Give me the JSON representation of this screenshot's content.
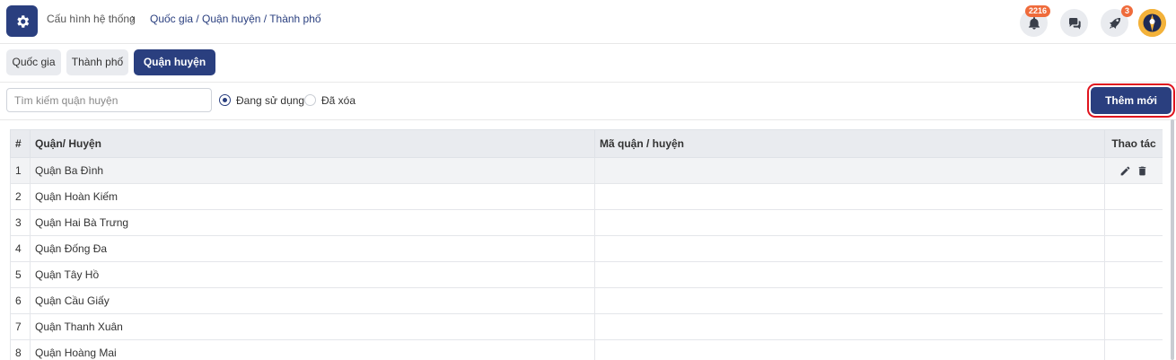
{
  "header": {
    "breadcrumb_root": "Cấu hình hệ thống",
    "breadcrumb_path": "Quốc gia / Quận huyện / Thành phố",
    "notification_count": "2216",
    "rocket_count": "3"
  },
  "tabs": [
    {
      "label": "Quốc gia"
    },
    {
      "label": "Thành phố"
    },
    {
      "label": "Quận huyện"
    }
  ],
  "toolbar": {
    "search_placeholder": "Tìm kiếm quận huyện",
    "radio_active": "Đang sử dụng",
    "radio_deleted": "Đã xóa",
    "add_button": "Thêm mới"
  },
  "table": {
    "headers": {
      "index": "#",
      "name": "Quận/ Huyện",
      "code": "Mã quận / huyện",
      "actions": "Thao tác"
    },
    "rows": [
      {
        "index": "1",
        "name": "Quận Ba Đình",
        "code": ""
      },
      {
        "index": "2",
        "name": "Quận Hoàn Kiếm",
        "code": ""
      },
      {
        "index": "3",
        "name": "Quận Hai Bà Trưng",
        "code": ""
      },
      {
        "index": "4",
        "name": "Quận Đống Đa",
        "code": ""
      },
      {
        "index": "5",
        "name": "Quận Tây Hồ",
        "code": ""
      },
      {
        "index": "6",
        "name": "Quận Cầu Giấy",
        "code": ""
      },
      {
        "index": "7",
        "name": "Quận Thanh Xuân",
        "code": ""
      },
      {
        "index": "8",
        "name": "Quận Hoàng Mai",
        "code": ""
      }
    ]
  },
  "colors": {
    "primary": "#2a3f7f",
    "badge": "#ef6b3b",
    "highlight": "#e0141e"
  }
}
